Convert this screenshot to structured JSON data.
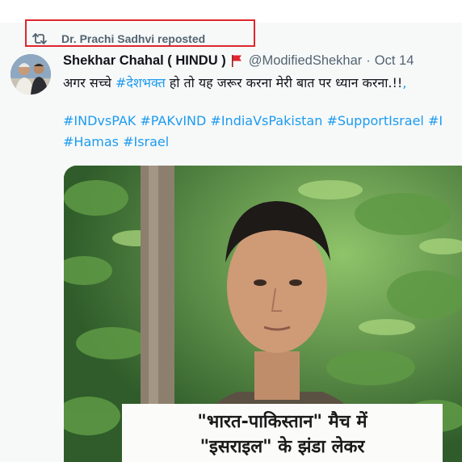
{
  "repost": {
    "text": "Dr. Prachi Sadhvi reposted",
    "icon": "repost-icon"
  },
  "author": {
    "display_name": "Shekhar Chahal ( HINDU )",
    "flag_icon": "red-flag-icon",
    "handle": "@ModifiedShekhar",
    "separator": "·",
    "date": "Oct 14"
  },
  "tweet": {
    "line1": [
      {
        "text": "अगर सच्चे ",
        "type": "text"
      },
      {
        "text": "#देशभक्त",
        "type": "hashtag"
      },
      {
        "text": " हो तो यह जरूर करना मेरी बात पर ध्यान करना.!!",
        "type": "text"
      }
    ],
    "line2": [
      "#INDvsPAK",
      "#PAKvIND",
      "#IndiaVsPakistan",
      "#SupportIsrael",
      "#I"
    ],
    "line3": [
      "#Hamas",
      "#Israel"
    ]
  },
  "media": {
    "caption_line1": "\"भारत-पाकिस्तान\" मैच में",
    "caption_line2": "\"इसराइल\" के झंडा लेकर"
  },
  "colors": {
    "link": "#1d9bf0",
    "secondary": "#536471",
    "primary": "#0f1419",
    "highlight": "#e0262e",
    "flag": "#e0262e"
  }
}
